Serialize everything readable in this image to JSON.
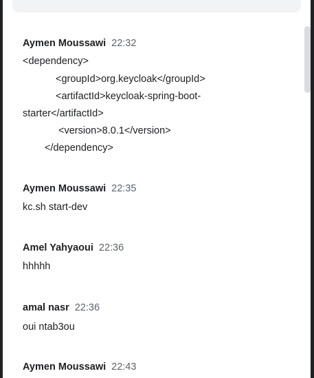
{
  "messages": [
    {
      "author": "Aymen Moussawi",
      "time": "22:32",
      "lines": [
        "<dependency>",
        "<groupId>org.keycloak</groupId>",
        "<artifactId>keycloak-spring-boot-",
        "starter</artifactId>",
        "<version>8.0.1</version>",
        "</dependency>"
      ]
    },
    {
      "author": "Aymen Moussawi",
      "time": "22:35",
      "lines": [
        "kc.sh start-dev"
      ]
    },
    {
      "author": "Amel Yahyaoui",
      "time": "22:36",
      "lines": [
        "hhhhh"
      ]
    },
    {
      "author": "amal nasr",
      "time": "22:36",
      "lines": [
        "oui ntab3ou"
      ]
    },
    {
      "author": "Aymen Moussawi",
      "time": "22:43",
      "lines": []
    }
  ]
}
